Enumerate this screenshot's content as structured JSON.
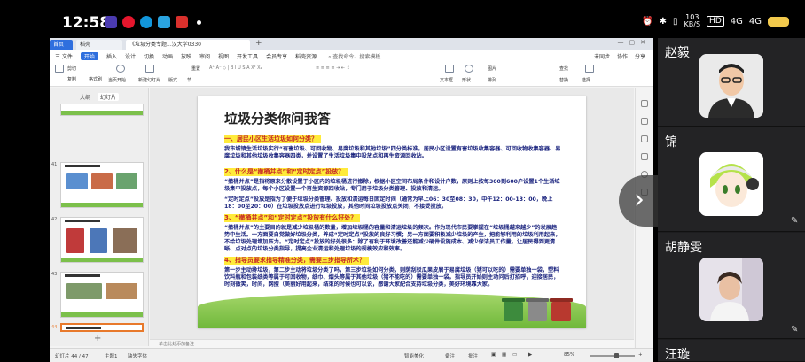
{
  "statusbar": {
    "time": "12:58",
    "net_speed_value": "103",
    "net_speed_unit": "KB/S",
    "hd": "HD",
    "signal1": "4G",
    "signal2": "4G"
  },
  "window": {
    "tabs": [
      "首页",
      "稻壳",
      "《垃圾分类专题...汉大学0330"
    ],
    "menu": [
      "三 文件",
      "开始",
      "插入",
      "设计",
      "切换",
      "动画",
      "放映",
      "审阅",
      "视图",
      "开发工具",
      "会员专享",
      "稻壳资源"
    ],
    "active_menu": "开始",
    "search": "查找命令、搜索模板",
    "menu_right": [
      "未同步",
      "协作",
      "分享"
    ]
  },
  "ribbon": {
    "items": [
      "剪切",
      "复制",
      "格式刷",
      "当页开始",
      "新建幻灯片",
      "版式",
      "节",
      "重置",
      "文本框",
      "形状",
      "图片",
      "排列",
      "查找",
      "替换",
      "选择"
    ]
  },
  "sidebar": {
    "tabs": [
      "大纲",
      "幻灯片"
    ],
    "active_tab": "幻灯片",
    "thumb_numbers": [
      "41",
      "42",
      "43",
      "44"
    ],
    "add": "+"
  },
  "slide": {
    "title": "垃圾分类你问我答",
    "q1": "一、居民小区生活垃圾如何分类？",
    "p1": "我市城镇生活垃圾实行“有害垃圾、可回收物、易腐垃圾和其他垃圾”四分类标准。居民小区设置有害垃圾收集容器、可回收物收集容器、易腐垃圾和其他垃圾收集容器四类，并设置了生活垃圾集中投放点和再生资源回收站。",
    "q2": "2、什么是“撤桶并点”和“定时定点”投放？",
    "p2": "“撤桶并点”是指将原来分散设置于小区内的垃圾桶进行撤除，根据小区空间布局条件和设计户数，原则上按每300到600户设置1个生活垃圾集中投放点，每个小区设置一个再生资源回收站，专门用于垃圾分类管理、投放和清运。",
    "p3": "“定时定点”投放是指为了便于垃圾分类管理、投放和清运每日固定时间（通常为早上06：30至08：30，中午12：00-13：00，晚上18：00至20：00）在垃圾投放点进行垃圾投放，其他时间垃圾投放点关闭，不接受投放。",
    "q3": "3、“撤桶并点”和“定时定点”投放有什么好处？",
    "p4": "“撤桶并点”的主要目的就是减少垃圾桶的数量，增加垃圾桶的容量和清运垃圾的频次。作为现代市民要掌握在“垃圾桶越来越少”的发展趋势中生活。一方面要自觉做好垃圾分类，养成“定时定点”投放的良好习惯；另一方面要积极减少垃圾的产生，把能够利用的垃圾利用起来，不给垃圾处理增加压力。“定时定点”投放的好处很多：除了有利于环境改善还能减少硬件设施成本、减少保洁员工作量，让居民得到更清晰、点对点的垃圾分类指导，提高企业清运和处理垃圾的规模效应和效率。",
    "q4": "4、指导员要求指导精准分类，需要三步指导所术？",
    "p5": "第一步主动搀垃圾，第二步主动将垃圾分类了吗，第三步垃圾如何分类，则荫刮驳瓜果皮屑于易腐垃圾（猪可以吃的）需要单独一袋，塑料饮料瓶和包装纸类等属于可回收物，纸巾、烟头等属于其他垃圾（猪不能吃的）需要单独一袋。指导员开始则主动问后打招呼，迎接居民，时刻微笑，时间，网搜（美丽好用起来，结束的时候也可以说，感谢大家配合支持垃圾分类，美好环境靠大家。"
  },
  "notes": "单击此处添加备注",
  "status": {
    "slide_counter": "幻灯片 44 / 47",
    "theme": "主题1",
    "font_missing": "缺失字体",
    "smart_beautify": "智能美化",
    "notes_btn": "备注",
    "comments_btn": "批注",
    "zoom": "85%",
    "zoom_level": 0.6
  },
  "overlay": {
    "next": "›"
  },
  "participants": [
    {
      "name": "赵毅"
    },
    {
      "name": "锦"
    },
    {
      "name": "胡静雯"
    },
    {
      "name": "汪璇"
    }
  ],
  "colors": {
    "accent": "#2f6fde",
    "highlight": "#ffeb3b",
    "question_text": "#c62828",
    "body_text": "#1a237e"
  }
}
